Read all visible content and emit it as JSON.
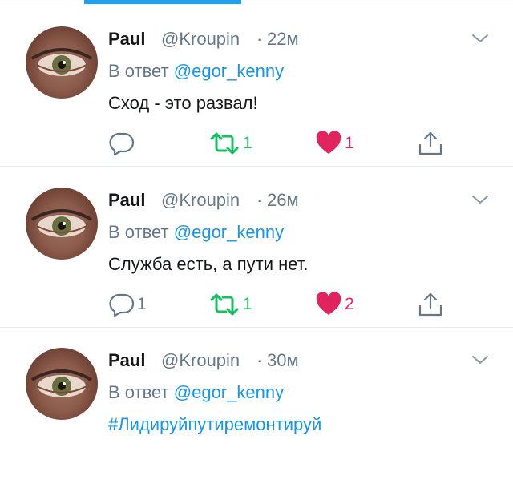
{
  "tweets": [
    {
      "author_name": "Paul",
      "handle": "@Kroupin",
      "separator": "·",
      "time": "22м",
      "reply_prefix": "В ответ",
      "reply_mention": "@egor_kenny",
      "text": "Сход - это развал!",
      "is_hashtag": false,
      "reply_count": "",
      "retweet_count": "1",
      "like_count": "1"
    },
    {
      "author_name": "Paul",
      "handle": "@Kroupin",
      "separator": "·",
      "time": "26м",
      "reply_prefix": "В ответ",
      "reply_mention": "@egor_kenny",
      "text": "Служба есть, а пути нет.",
      "is_hashtag": false,
      "reply_count": "1",
      "retweet_count": "1",
      "like_count": "2"
    },
    {
      "author_name": "Paul",
      "handle": "@Kroupin",
      "separator": "·",
      "time": "30м",
      "reply_prefix": "В ответ",
      "reply_mention": "@egor_kenny",
      "text": "#Лидируйпутиремонтируй",
      "is_hashtag": true,
      "reply_count": "",
      "retweet_count": "",
      "like_count": ""
    }
  ],
  "icons": {
    "reply": "reply-icon",
    "retweet": "retweet-icon",
    "like": "heart-icon",
    "share": "share-icon",
    "caret": "chevron-down-icon"
  },
  "colors": {
    "accent": "#1da1f2",
    "mention": "#1b95e0",
    "retweet_active": "#17bf63",
    "like_active": "#e0245e",
    "secondary_text": "#657786"
  }
}
